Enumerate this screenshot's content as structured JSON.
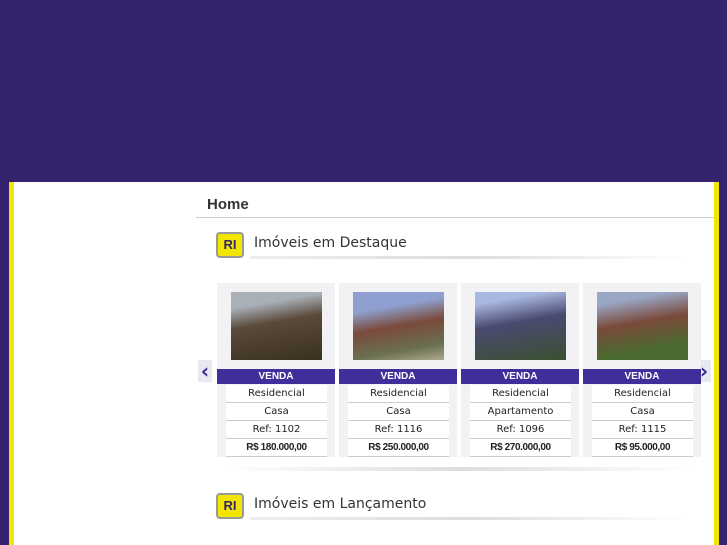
{
  "page": {
    "title": "Home"
  },
  "sections": [
    {
      "title": "Imóveis em Destaque",
      "logo": "RI"
    },
    {
      "title": "Imóveis em Lançamento",
      "logo": "RI"
    }
  ],
  "cards": [
    {
      "badge": "VENDA",
      "category": "Residencial",
      "type": "Casa",
      "ref": "Ref: 1102",
      "price": "R$ 180.000,00"
    },
    {
      "badge": "VENDA",
      "category": "Residencial",
      "type": "Casa",
      "ref": "Ref: 1116",
      "price": "R$ 250.000,00"
    },
    {
      "badge": "VENDA",
      "category": "Residencial",
      "type": "Apartamento",
      "ref": "Ref: 1096",
      "price": "R$ 270.000,00"
    },
    {
      "badge": "VENDA",
      "category": "Residencial",
      "type": "Casa",
      "ref": "Ref: 1115",
      "price": "R$ 95.000,00"
    }
  ],
  "nav": {
    "prev": "‹",
    "next": "›"
  }
}
